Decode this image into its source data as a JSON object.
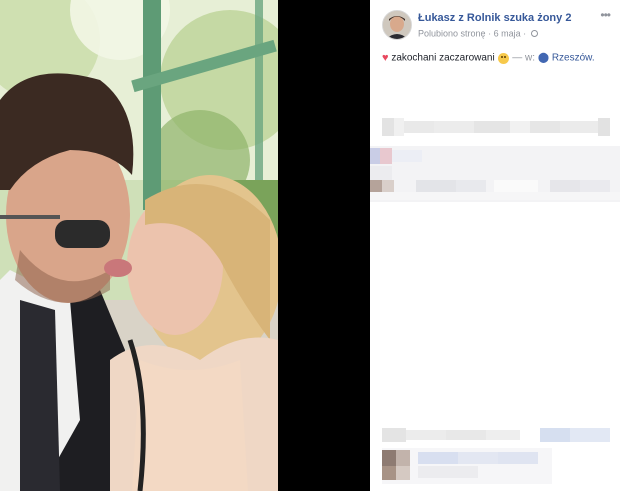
{
  "post": {
    "page_name": "Łukasz z Rolnik szuka żony 2",
    "liked_label": "Polubiono stronę",
    "dot": "·",
    "date": "6 maja",
    "status_text": "zakochani zaczarowani",
    "location_prefix": "— w:",
    "location": "Rzeszów."
  },
  "icons": {
    "more": "more-options-icon",
    "privacy": "globe-icon",
    "feeling": "heart-icon",
    "emoji": "smile-emoji-icon",
    "location": "map-pin-icon"
  },
  "colors": {
    "link": "#365899",
    "meta": "#90949c",
    "heart": "#e8485f",
    "text": "#1d2129"
  }
}
